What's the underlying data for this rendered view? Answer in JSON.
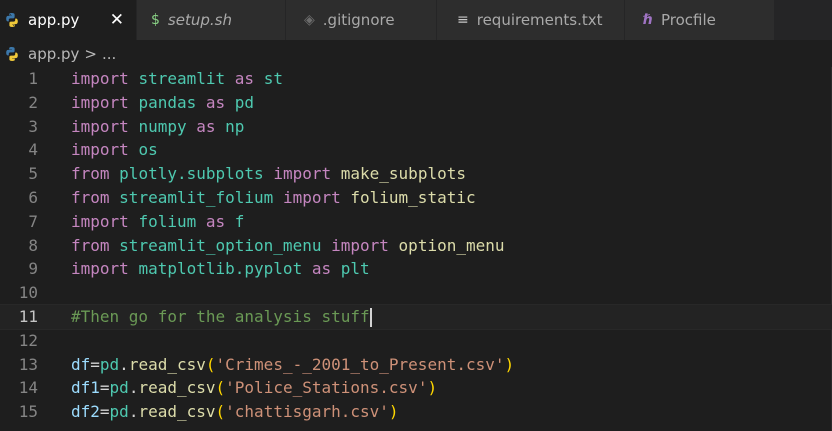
{
  "tabs": [
    {
      "label": "app.py",
      "icon": "python-icon",
      "active": true
    },
    {
      "label": "setup.sh",
      "icon": "dollar-icon",
      "active": false
    },
    {
      "label": ".gitignore",
      "icon": "diamond-icon",
      "active": false
    },
    {
      "label": "requirements.txt",
      "icon": "lines-icon",
      "active": false
    },
    {
      "label": "Procfile",
      "icon": "heroku-icon",
      "active": false
    }
  ],
  "tab_glyphs": {
    "dollar": "$",
    "diamond": "◈",
    "lines": "≡",
    "heroku": "ℏ",
    "close": "✕"
  },
  "breadcrumb": {
    "file": "app.py",
    "separator": ">",
    "tail": "..."
  },
  "lines": [
    {
      "n": "1",
      "tokens": [
        [
          "kw",
          "import"
        ],
        [
          "plain",
          " "
        ],
        [
          "mod",
          "streamlit"
        ],
        [
          "plain",
          " "
        ],
        [
          "kw",
          "as"
        ],
        [
          "plain",
          " "
        ],
        [
          "mod",
          "st"
        ]
      ]
    },
    {
      "n": "2",
      "tokens": [
        [
          "kw",
          "import"
        ],
        [
          "plain",
          " "
        ],
        [
          "mod",
          "pandas"
        ],
        [
          "plain",
          " "
        ],
        [
          "kw",
          "as"
        ],
        [
          "plain",
          " "
        ],
        [
          "mod",
          "pd"
        ]
      ]
    },
    {
      "n": "3",
      "tokens": [
        [
          "kw",
          "import"
        ],
        [
          "plain",
          " "
        ],
        [
          "mod",
          "numpy"
        ],
        [
          "plain",
          " "
        ],
        [
          "kw",
          "as"
        ],
        [
          "plain",
          " "
        ],
        [
          "mod",
          "np"
        ]
      ]
    },
    {
      "n": "4",
      "tokens": [
        [
          "kw",
          "import"
        ],
        [
          "plain",
          " "
        ],
        [
          "mod",
          "os"
        ]
      ]
    },
    {
      "n": "5",
      "tokens": [
        [
          "kw",
          "from"
        ],
        [
          "plain",
          " "
        ],
        [
          "mod",
          "plotly.subplots"
        ],
        [
          "plain",
          " "
        ],
        [
          "kw",
          "import"
        ],
        [
          "plain",
          " "
        ],
        [
          "fn",
          "make_subplots"
        ]
      ]
    },
    {
      "n": "6",
      "tokens": [
        [
          "kw",
          "from"
        ],
        [
          "plain",
          " "
        ],
        [
          "mod",
          "streamlit_folium"
        ],
        [
          "plain",
          " "
        ],
        [
          "kw",
          "import"
        ],
        [
          "plain",
          " "
        ],
        [
          "fn",
          "folium_static"
        ]
      ]
    },
    {
      "n": "7",
      "tokens": [
        [
          "kw",
          "import"
        ],
        [
          "plain",
          " "
        ],
        [
          "mod",
          "folium"
        ],
        [
          "plain",
          " "
        ],
        [
          "kw",
          "as"
        ],
        [
          "plain",
          " "
        ],
        [
          "mod",
          "f"
        ]
      ]
    },
    {
      "n": "8",
      "tokens": [
        [
          "kw",
          "from"
        ],
        [
          "plain",
          " "
        ],
        [
          "mod",
          "streamlit_option_menu"
        ],
        [
          "plain",
          " "
        ],
        [
          "kw",
          "import"
        ],
        [
          "plain",
          " "
        ],
        [
          "fn",
          "option_menu"
        ]
      ]
    },
    {
      "n": "9",
      "tokens": [
        [
          "kw",
          "import"
        ],
        [
          "plain",
          " "
        ],
        [
          "mod",
          "matplotlib.pyplot"
        ],
        [
          "plain",
          " "
        ],
        [
          "kw",
          "as"
        ],
        [
          "plain",
          " "
        ],
        [
          "mod",
          "plt"
        ]
      ]
    },
    {
      "n": "10",
      "tokens": []
    },
    {
      "n": "11",
      "current": true,
      "tokens": [
        [
          "cmt",
          "#Then go for the analysis stuff"
        ]
      ]
    },
    {
      "n": "12",
      "tokens": []
    },
    {
      "n": "13",
      "tokens": [
        [
          "var",
          "df"
        ],
        [
          "plain",
          "="
        ],
        [
          "mod",
          "pd"
        ],
        [
          "plain",
          "."
        ],
        [
          "fn",
          "read_csv"
        ],
        [
          "paren",
          "("
        ],
        [
          "str",
          "'Crimes_-_2001_to_Present.csv'"
        ],
        [
          "paren",
          ")"
        ]
      ]
    },
    {
      "n": "14",
      "tokens": [
        [
          "var",
          "df1"
        ],
        [
          "plain",
          "="
        ],
        [
          "mod",
          "pd"
        ],
        [
          "plain",
          "."
        ],
        [
          "fn",
          "read_csv"
        ],
        [
          "paren",
          "("
        ],
        [
          "str",
          "'Police_Stations.csv'"
        ],
        [
          "paren",
          ")"
        ]
      ]
    },
    {
      "n": "15",
      "tokens": [
        [
          "var",
          "df2"
        ],
        [
          "plain",
          "="
        ],
        [
          "mod",
          "pd"
        ],
        [
          "plain",
          "."
        ],
        [
          "fn",
          "read_csv"
        ],
        [
          "paren",
          "("
        ],
        [
          "str",
          "'chattisgarh.csv'"
        ],
        [
          "paren",
          ")"
        ]
      ]
    }
  ]
}
